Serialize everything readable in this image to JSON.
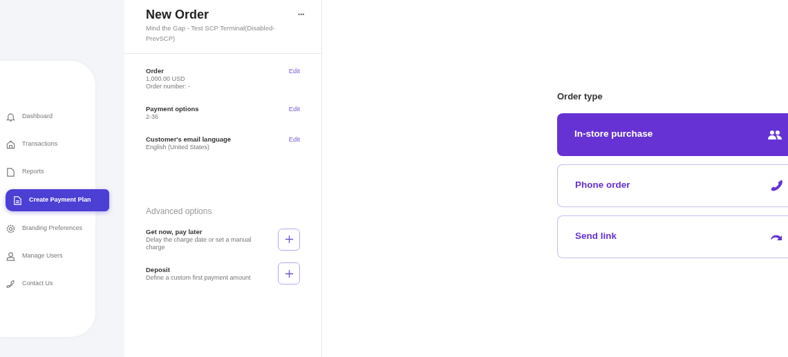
{
  "sidebar": {
    "items": [
      {
        "label": "Dashboard",
        "selected": false
      },
      {
        "label": "Transactions",
        "selected": false
      },
      {
        "label": "Reports",
        "selected": false
      },
      {
        "label": "Create Payment Plan",
        "selected": true
      },
      {
        "label": "Branding Preferences",
        "selected": false
      },
      {
        "label": "Manage Users",
        "selected": false
      },
      {
        "label": "Contact Us",
        "selected": false
      }
    ]
  },
  "order_panel": {
    "title": "New Order",
    "menu": "•••",
    "subtitle": "Mind the Gap - Test SCP Terminal(Disabled-PrevSCP)",
    "sections": [
      {
        "heading": "Order",
        "action": "Edit",
        "lines": [
          "1,000.00 USD",
          "Order number: -"
        ]
      },
      {
        "heading": "Payment options",
        "action": "Edit",
        "lines": [
          "2-36"
        ]
      },
      {
        "heading": "Customer's email language",
        "action": "Edit",
        "lines": [
          "English (United States)"
        ]
      }
    ],
    "advanced_heading": "Advanced options",
    "advanced_options": [
      {
        "title": "Get now, pay later",
        "description": "Delay the charge date or set a manual charge"
      },
      {
        "title": "Deposit",
        "description": "Define a custom first payment amount"
      }
    ]
  },
  "order_type": {
    "heading": "Order type",
    "options": [
      {
        "label": "In-store purchase",
        "selected": true
      },
      {
        "label": "Phone order",
        "selected": false
      },
      {
        "label": "Send link",
        "selected": false
      }
    ]
  }
}
